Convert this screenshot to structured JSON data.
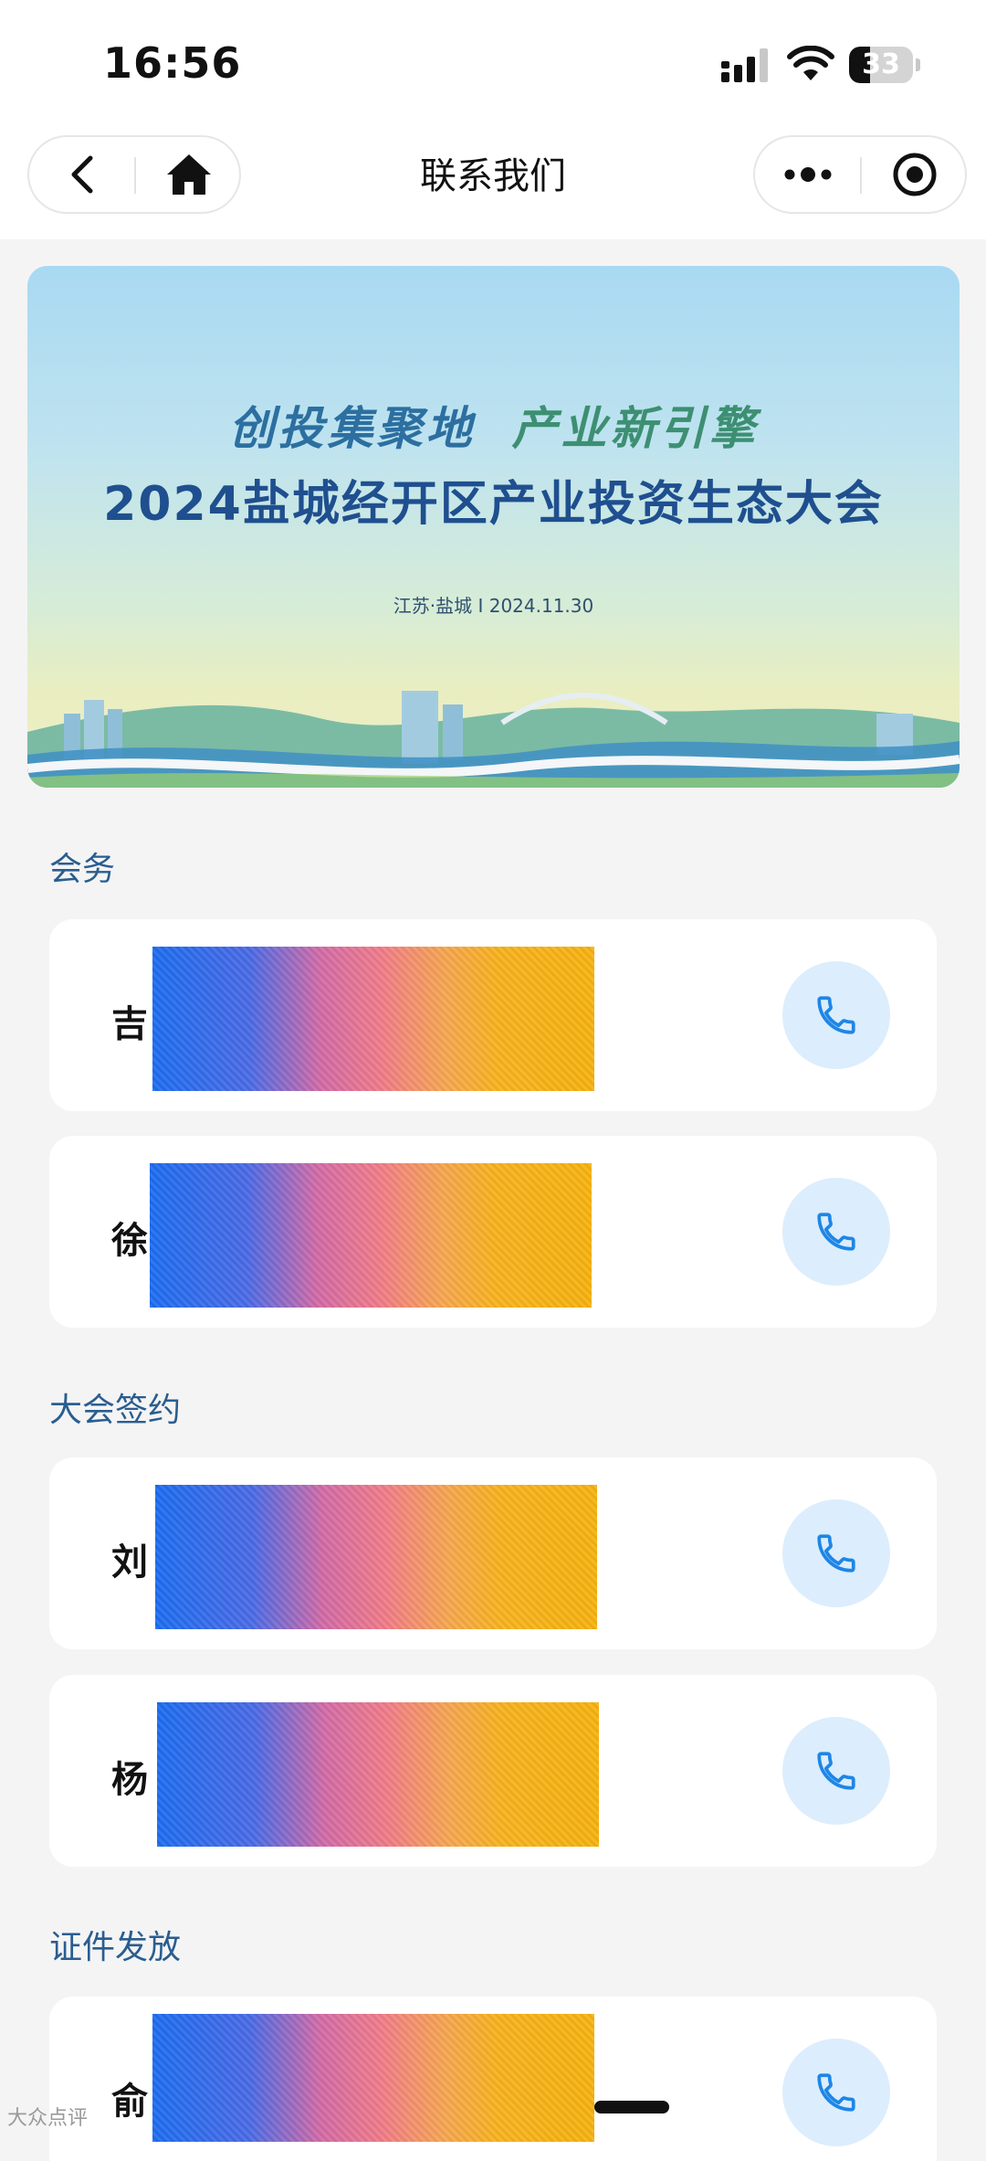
{
  "status_bar": {
    "time": "16:56",
    "battery": "33",
    "battery_level": 0.33
  },
  "nav": {
    "title": "联系我们"
  },
  "banner": {
    "slogan_part1": "创投集聚地",
    "slogan_part2": "产业新引擎",
    "title": "2024盐城经开区产业投资生态大会",
    "subtitle": "江苏·盐城  I  2024.11.30"
  },
  "sections": [
    {
      "title": "会务",
      "contacts": [
        {
          "name": "吉"
        },
        {
          "name": "徐"
        }
      ]
    },
    {
      "title": "大会签约",
      "contacts": [
        {
          "name": "刘"
        },
        {
          "name": "杨"
        }
      ]
    },
    {
      "title": "证件发放",
      "contacts": [
        {
          "name": "俞"
        }
      ]
    }
  ],
  "watermark": "大众点评",
  "colors": {
    "accent": "#2a5d8f",
    "call_button_bg": "#dcedfd",
    "call_icon": "#1e86e6",
    "background": "#f4f4f5"
  },
  "icons": {
    "back": "chevron-left-icon",
    "home": "home-icon",
    "more": "more-dots-icon",
    "close": "target-circle-icon",
    "call": "phone-icon"
  }
}
